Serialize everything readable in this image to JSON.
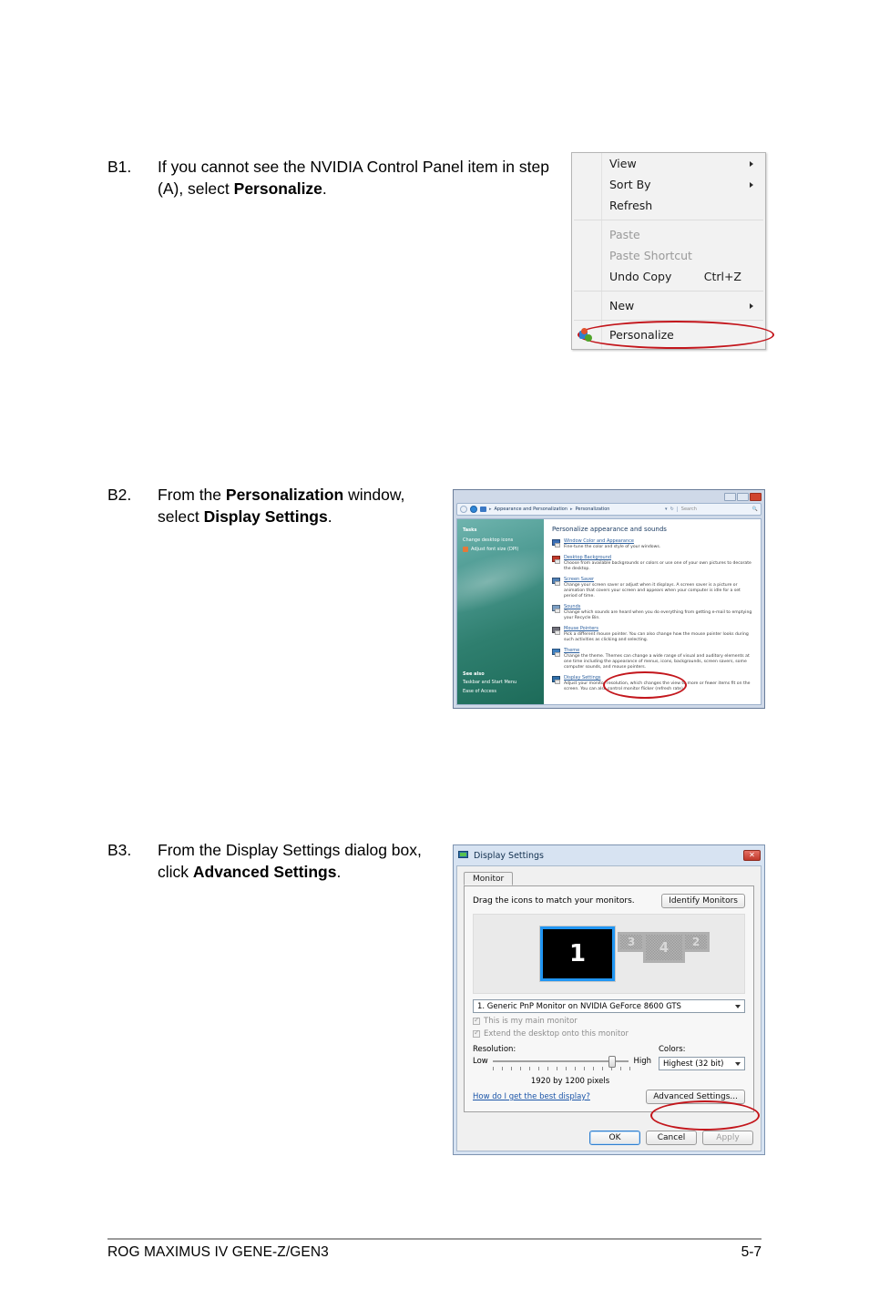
{
  "page": {
    "footer_left": "ROG MAXIMUS IV GENE-Z/GEN3",
    "footer_right": "5-7"
  },
  "steps": [
    {
      "num": "B1.",
      "parts": [
        {
          "t": "If you cannot see the NVIDIA Control Panel item in step (A), select ",
          "b": false
        },
        {
          "t": "Personalize",
          "b": true
        },
        {
          "t": ".",
          "b": false
        }
      ]
    },
    {
      "num": "B2.",
      "parts": [
        {
          "t": "From the ",
          "b": false
        },
        {
          "t": "Personalization",
          "b": true
        },
        {
          "t": " window, select ",
          "b": false
        },
        {
          "t": "Display Settings",
          "b": true
        },
        {
          "t": ".",
          "b": false
        }
      ]
    },
    {
      "num": "B3.",
      "parts": [
        {
          "t": "From the Display Settings dialog box, click ",
          "b": false
        },
        {
          "t": "Advanced Settings",
          "b": true
        },
        {
          "t": ".",
          "b": false
        }
      ]
    }
  ],
  "context_menu": {
    "items": [
      {
        "label": "View",
        "accel": "",
        "submenu": true,
        "disabled": false,
        "icon": ""
      },
      {
        "label": "Sort By",
        "accel": "",
        "submenu": true,
        "disabled": false,
        "icon": ""
      },
      {
        "label": "Refresh",
        "accel": "",
        "submenu": false,
        "disabled": false,
        "icon": ""
      },
      {
        "label": "Paste",
        "accel": "",
        "submenu": false,
        "disabled": true,
        "icon": ""
      },
      {
        "label": "Paste Shortcut",
        "accel": "",
        "submenu": false,
        "disabled": true,
        "icon": ""
      },
      {
        "label": "Undo Copy",
        "accel": "Ctrl+Z",
        "submenu": false,
        "disabled": false,
        "icon": ""
      },
      {
        "label": "New",
        "accel": "",
        "submenu": true,
        "disabled": false,
        "icon": ""
      },
      {
        "label": "Personalize",
        "accel": "",
        "submenu": false,
        "disabled": false,
        "icon": "personalize-icon"
      }
    ],
    "highlight_color": "#c3161c"
  },
  "personalization_window": {
    "breadcrumb_1": "Appearance and Personalization",
    "breadcrumb_2": "Personalization",
    "search_placeholder": "Search",
    "tasks_heading": "Tasks",
    "tasks_links": [
      "Change desktop icons",
      "Adjust font size (DPI)"
    ],
    "see_also_heading": "See also",
    "see_also_links": [
      "Taskbar and Start Menu",
      "Ease of Access"
    ],
    "content_title": "Personalize appearance and sounds",
    "items": [
      {
        "name": "Window Color and Appearance",
        "desc": "Fine-tune the color and style of your windows."
      },
      {
        "name": "Desktop Background",
        "desc": "Choose from available backgrounds or colors or use one of your own pictures to decorate the desktop."
      },
      {
        "name": "Screen Saver",
        "desc": "Change your screen saver or adjust when it displays. A screen saver is a picture or animation that covers your screen and appears when your computer is idle for a set period of time."
      },
      {
        "name": "Sounds",
        "desc": "Change which sounds are heard when you do everything from getting e-mail to emptying your Recycle Bin."
      },
      {
        "name": "Mouse Pointers",
        "desc": "Pick a different mouse pointer. You can also change how the mouse pointer looks during such activities as clicking and selecting."
      },
      {
        "name": "Theme",
        "desc": "Change the theme. Themes can change a wide range of visual and auditory elements at one time including the appearance of menus, icons, backgrounds, screen savers, some computer sounds, and mouse pointers."
      },
      {
        "name": "Display Settings",
        "desc": "Adjust your monitor resolution, which changes the view to more or fewer items fit on the screen. You can also control monitor flicker (refresh rate)."
      }
    ]
  },
  "display_settings_dialog": {
    "title": "Display Settings",
    "tab": "Monitor",
    "drag_label": "Drag the icons to match your monitors.",
    "identify_button": "Identify Monitors",
    "monitors": [
      {
        "number": "1",
        "state": "selected"
      },
      {
        "number": "3",
        "state": "inactive"
      },
      {
        "number": "4",
        "state": "inactive"
      },
      {
        "number": "2",
        "state": "inactive"
      }
    ],
    "monitor_select": "1. Generic PnP Monitor on NVIDIA GeForce 8600 GTS",
    "checkbox_main": "This is my main monitor",
    "checkbox_extend": "Extend the desktop onto this monitor",
    "resolution_label": "Resolution:",
    "resolution_low": "Low",
    "resolution_high": "High",
    "resolution_value": "1920 by 1200 pixels",
    "colors_label": "Colors:",
    "colors_value": "Highest (32 bit)",
    "help_link": "How do I get the best display?",
    "advanced_button": "Advanced Settings...",
    "ok_button": "OK",
    "cancel_button": "Cancel",
    "apply_button": "Apply"
  }
}
